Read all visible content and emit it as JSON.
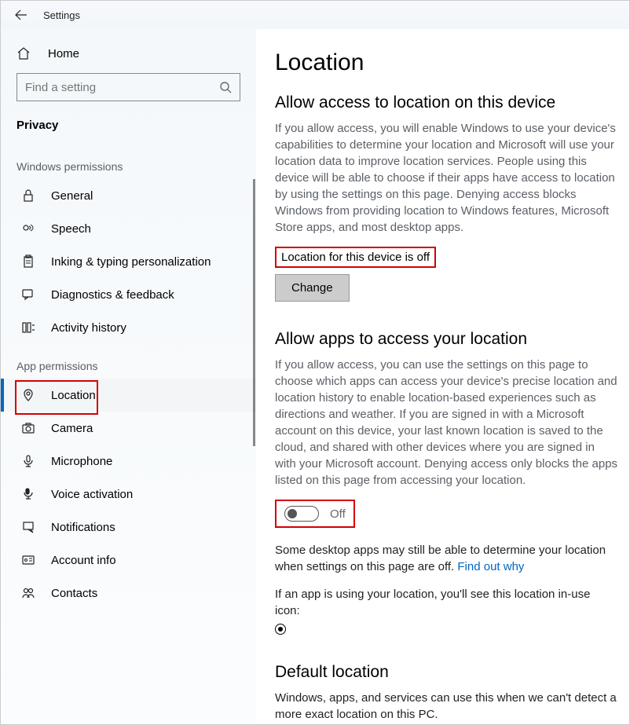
{
  "titlebar": {
    "title": "Settings"
  },
  "sidebar": {
    "home": "Home",
    "search_placeholder": "Find a setting",
    "section": "Privacy",
    "group_win": "Windows permissions",
    "group_app": "App permissions",
    "win_items": [
      {
        "label": "General"
      },
      {
        "label": "Speech"
      },
      {
        "label": "Inking & typing personalization"
      },
      {
        "label": "Diagnostics & feedback"
      },
      {
        "label": "Activity history"
      }
    ],
    "app_items": [
      {
        "label": "Location"
      },
      {
        "label": "Camera"
      },
      {
        "label": "Microphone"
      },
      {
        "label": "Voice activation"
      },
      {
        "label": "Notifications"
      },
      {
        "label": "Account info"
      },
      {
        "label": "Contacts"
      }
    ]
  },
  "main": {
    "page_title": "Location",
    "s1_heading": "Allow access to location on this device",
    "s1_body": "If you allow access, you will enable Windows to use your device's capabilities to determine your location and Microsoft will use your location data to improve location services. People using this device will be able to choose if their apps have access to location by using the settings on this page. Denying access blocks Windows from providing location to Windows features, Microsoft Store apps, and most desktop apps.",
    "s1_status": "Location for this device is off",
    "s1_change": "Change",
    "s2_heading": "Allow apps to access your location",
    "s2_body": "If you allow access, you can use the settings on this page to choose which apps can access your device's precise location and location history to enable location-based experiences such as directions and weather. If you are signed in with a Microsoft account on this device, your last known location is saved to the cloud, and shared with other devices where you are signed in with your Microsoft account. Denying access only blocks the apps listed on this page from accessing your location.",
    "s2_toggle": "Off",
    "s2_note1a": "Some desktop apps may still be able to determine your location when settings on this page are off. ",
    "s2_note1b": "Find out why",
    "s2_note2": "If an app is using your location, you'll see this location in-use icon:",
    "s3_heading": "Default location",
    "s3_body": "Windows, apps, and services can use this when we can't detect a more exact location on this PC."
  }
}
